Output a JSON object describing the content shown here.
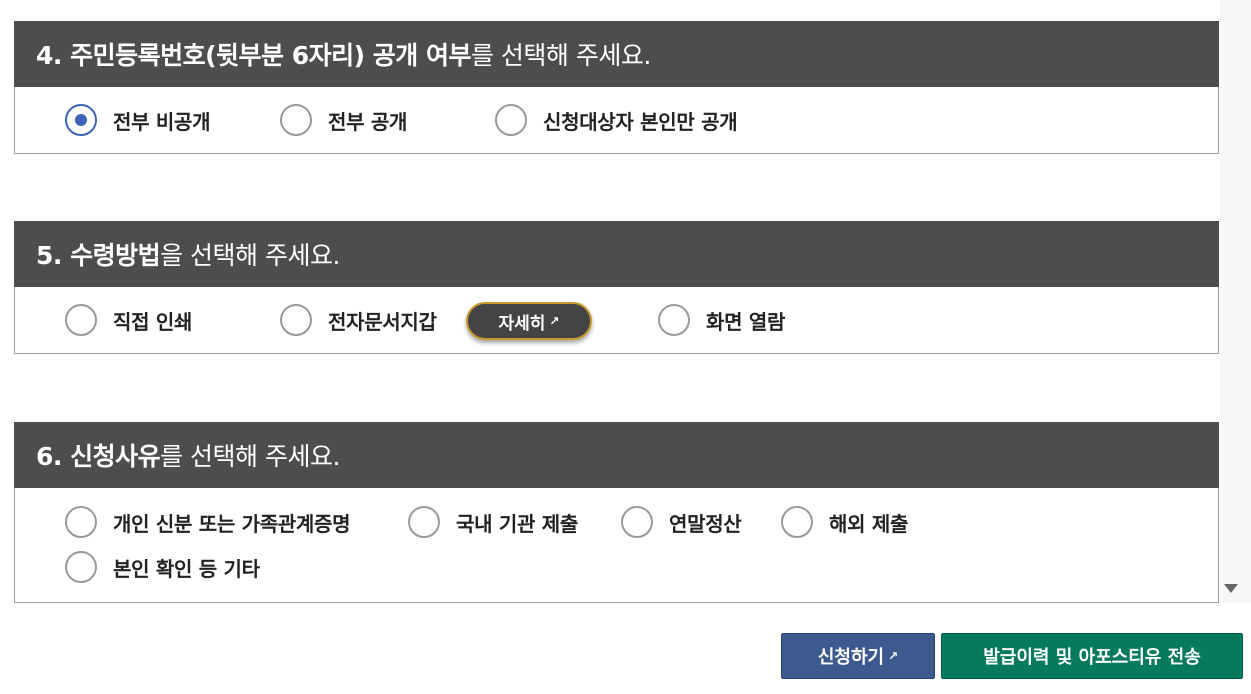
{
  "sections": [
    {
      "title_bold": "4. 주민등록번호(뒷부분 6자리) 공개 여부",
      "title_rest": "를 선택해 주세요.",
      "options": [
        {
          "label": "전부 비공개",
          "checked": true
        },
        {
          "label": "전부 공개",
          "checked": false
        },
        {
          "label": "신청대상자 본인만 공개",
          "checked": false
        }
      ]
    },
    {
      "title_bold": "5. 수령방법",
      "title_rest": "을 선택해 주세요.",
      "options": [
        {
          "label": "직접 인쇄",
          "checked": false
        },
        {
          "label": "전자문서지갑",
          "checked": false
        },
        {
          "label": "화면 열람",
          "checked": false
        }
      ],
      "detail_button": {
        "label": "자세히",
        "icon": "external-link-icon"
      }
    },
    {
      "title_bold": "6. 신청사유",
      "title_rest": "를 선택해 주세요.",
      "options": [
        {
          "label": "개인 신분 또는 가족관계증명",
          "checked": false
        },
        {
          "label": "국내 기관 제출",
          "checked": false
        },
        {
          "label": "연말정산",
          "checked": false
        },
        {
          "label": "해외 제출",
          "checked": false
        },
        {
          "label": "본인 확인 등 기타",
          "checked": false
        }
      ]
    }
  ],
  "buttons": {
    "apply": {
      "label": "신청하기",
      "icon": "external-link-icon",
      "color": "#3d5a8f"
    },
    "send": {
      "label": "발급이력 및 아포스티유 전송",
      "color": "#057a5e"
    }
  },
  "colors": {
    "header_bg": "#4d4d4d",
    "radio_checked": "#3d63b8",
    "detail_border": "#c79a2a"
  }
}
